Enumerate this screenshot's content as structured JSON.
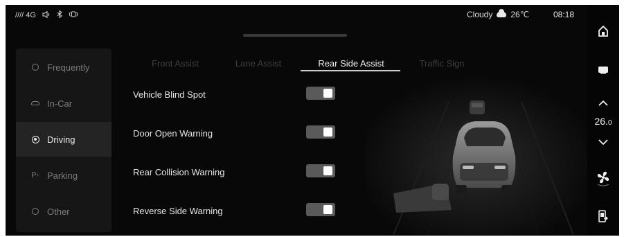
{
  "status_bar": {
    "signal": "//// 4G",
    "weather": "Cloudy",
    "temperature": "26℃",
    "time": "08:18"
  },
  "menu": {
    "items": [
      {
        "label": "Frequently",
        "icon": "gear-ring-icon",
        "active": false
      },
      {
        "label": "In-Car",
        "icon": "car-outline-icon",
        "active": false
      },
      {
        "label": "Driving",
        "icon": "steering-wheel-icon",
        "active": true
      },
      {
        "label": "Parking",
        "icon": "parking-icon",
        "active": false
      },
      {
        "label": "Other",
        "icon": "more-circle-icon",
        "active": false
      }
    ]
  },
  "tabs": [
    {
      "label": "Front Assist",
      "active": false
    },
    {
      "label": "Lane Assist",
      "active": false
    },
    {
      "label": "Rear Side Assist",
      "active": true
    },
    {
      "label": "Traffic Sign",
      "active": false
    }
  ],
  "settings": [
    {
      "label": "Vehicle Blind Spot",
      "enabled": true
    },
    {
      "label": "Door Open Warning",
      "enabled": true
    },
    {
      "label": "Rear Collision Warning",
      "enabled": true
    },
    {
      "label": "Reverse Side Warning",
      "enabled": true
    }
  ],
  "right_rail": {
    "ac_temperature": "26.",
    "ac_temperature_decimal": "0",
    "icons": [
      "home-icon",
      "screen-icon",
      "chevron-up-icon",
      "chevron-down-icon",
      "fan-icon",
      "exit-door-icon"
    ]
  },
  "colors": {
    "background": "#080808",
    "menu_background": "#161616",
    "menu_active": "#242424",
    "toggle_track": "#5a5a5a",
    "toggle_knob": "#ffffff"
  }
}
